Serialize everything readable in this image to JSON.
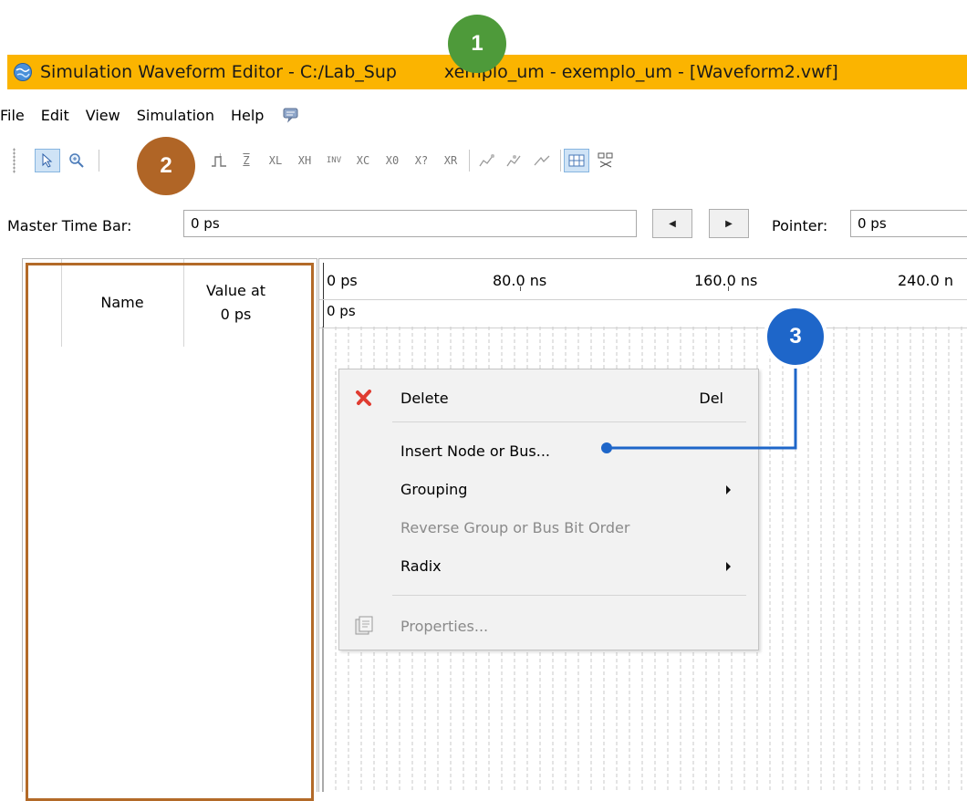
{
  "window": {
    "title": "Simulation Waveform Editor - C:/Lab_Sup…exemplo_um - exemplo_um - [Waveform2.vwf]",
    "title_before": "Simulation Waveform Editor - C:/Lab_Sup",
    "title_after": "xemplo_um - exemplo_um - [Waveform2.vwf]"
  },
  "menu": {
    "items": [
      "File",
      "Edit",
      "View",
      "Simulation",
      "Help"
    ],
    "extra_icon": "speech-bubble-icon"
  },
  "toolbar": {
    "icons": [
      "pointer-icon",
      "zoom-icon",
      "waveform-icon",
      "z-value-icon",
      "xl-icon",
      "xh-icon",
      "invert-icon",
      "xc-icon",
      "x0-icon",
      "x-question-icon",
      "xr-icon",
      "snap-icon",
      "snap2-icon",
      "arrow-icon",
      "grid-icon",
      "radix-icon"
    ],
    "glyphs": {
      "xl": "XL",
      "xh": "XH",
      "inv": "INV",
      "xc": "XC",
      "x0": "X0",
      "xq": "X?",
      "xr": "XR",
      "z": "Z"
    }
  },
  "master_time_bar": {
    "label": "Master Time Bar:",
    "value": "0 ps",
    "prev_label": "◀",
    "next_label": "▶",
    "pointer_label": "Pointer:",
    "pointer_value": "0 ps"
  },
  "node_panel": {
    "col_name": "Name",
    "col_value_line1": "Value at",
    "col_value_line2": "0 ps"
  },
  "waveform": {
    "ruler_ticks": [
      "0 ps",
      "80.0 ns",
      "160.0 ns",
      "240.0 n"
    ],
    "cursor_label": "0 ps"
  },
  "context_menu": {
    "delete_label": "Delete",
    "delete_shortcut": "Del",
    "insert_label": "Insert Node or Bus...",
    "grouping_label": "Grouping",
    "reverse_label": "Reverse Group or Bus Bit Order",
    "radix_label": "Radix",
    "properties_label": "Properties..."
  },
  "callouts": {
    "one": "1",
    "two": "2",
    "three": "3"
  },
  "colors": {
    "titlebar": "#fbb400",
    "callout_1": "#4e9a3a",
    "callout_2": "#b06526",
    "callout_3": "#1e66c9",
    "highlight_box": "#b36a28",
    "delete_icon": "#e03c31"
  }
}
